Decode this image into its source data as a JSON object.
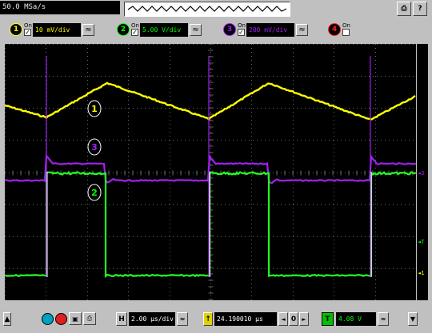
{
  "top_bar": {
    "sample_rate": "50.0 MSa/s",
    "window_buttons": [
      {
        "name": "print-icon",
        "glyph": "⎙"
      },
      {
        "name": "help-icon",
        "glyph": "?"
      }
    ]
  },
  "channels": [
    {
      "number": "1",
      "on_label": "On",
      "checked": true,
      "scale": "10 mV/div",
      "color": "#ffff00"
    },
    {
      "number": "2",
      "on_label": "On",
      "checked": true,
      "scale": "5.00 V/div",
      "color": "#00ff00"
    },
    {
      "number": "3",
      "on_label": "On",
      "checked": true,
      "scale": "200 mV/div",
      "color": "#a020f0"
    },
    {
      "number": "4",
      "on_label": "On",
      "checked": false,
      "scale": "",
      "color": "#ff2020"
    }
  ],
  "trace_labels": [
    {
      "text": "1",
      "color": "#ffff00"
    },
    {
      "text": "3",
      "color": "#a020f0"
    },
    {
      "text": "2",
      "color": "#00ff00"
    }
  ],
  "right_markers": {
    "ch3": "3",
    "trigger": "T",
    "ch2_ground": "1"
  },
  "bottom_bar": {
    "horizontal_label": "H",
    "time_per_div": "2.00 µs/div",
    "delay": "24.190010 µs",
    "trigger_label": "T",
    "trigger_level": "4.08 V",
    "delay_zero": "0",
    "delay_icon": "↑"
  },
  "colors": {
    "ch1": "#ffff00",
    "ch2": "#00ff00",
    "ch3": "#a020f0",
    "ch4": "#ff2020",
    "grid": "#6a6a6a",
    "screen": "#000000"
  }
}
